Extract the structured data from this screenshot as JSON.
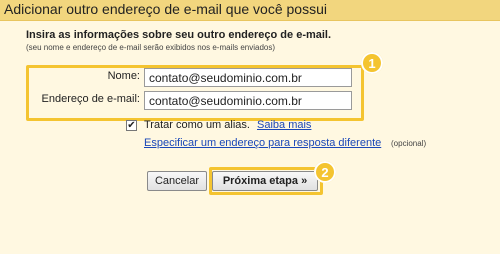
{
  "header": {
    "title": "Adicionar outro endereço de e-mail que você possui"
  },
  "form": {
    "intro": "Insira as informações sobre seu outro endereço de e-mail.",
    "intro_note": "(seu nome e endereço de e-mail serão exibidos nos e-mails enviados)",
    "nome_label": "Nome:",
    "nome_value": "contato@seudominio.com.br",
    "email_label": "Endereço de e-mail:",
    "email_value": "contato@seudominio.com.br",
    "alias_checked": true,
    "alias_checkmark": "✔",
    "alias_label": "Tratar como um alias.",
    "saiba_mais": "Saiba mais",
    "especificar_link": "Especificar um endereço para resposta diferente",
    "opcional": "(opcional)"
  },
  "badges": {
    "one": "1",
    "two": "2"
  },
  "buttons": {
    "cancel": "Cancelar",
    "next": "Próxima etapa »"
  },
  "colors": {
    "accent": "#f4c430",
    "link": "#1a47b8",
    "header_bg": "#f2d67e",
    "panel_bg": "#fff8e1"
  }
}
